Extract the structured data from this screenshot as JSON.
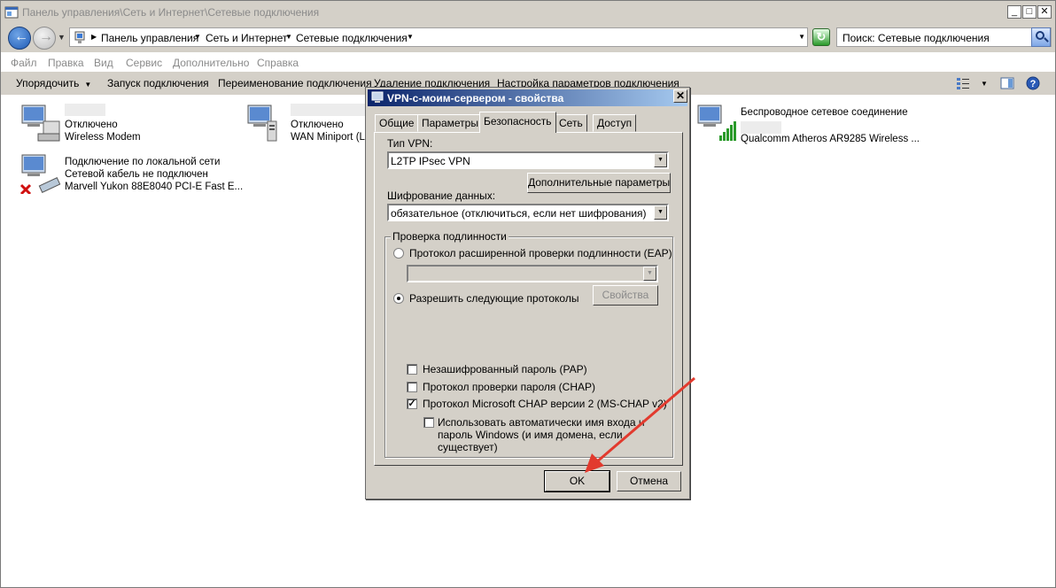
{
  "window": {
    "title": "Панель управления\\Сеть и Интернет\\Сетевые подключения",
    "minimize": "_",
    "maximize": "□",
    "close": "✕"
  },
  "address": {
    "crumbs": [
      "Панель управления",
      "Сеть и Интернет",
      "Сетевые подключения"
    ],
    "search_placeholder": "Поиск: Сетевые подключения"
  },
  "menu": [
    "Файл",
    "Правка",
    "Вид",
    "Сервис",
    "Дополнительно",
    "Справка"
  ],
  "commands": {
    "organize": "Упорядочить",
    "start": "Запуск подключения",
    "rename": "Переименование подключения",
    "delete": "Удаление подключения",
    "settings": "Настройка параметров подключения"
  },
  "connections": [
    {
      "status": "Отключено",
      "device": "Wireless Modem"
    },
    {
      "status": "Отключено",
      "device": "WAN Miniport (L2T"
    },
    {
      "name": "Беспроводное сетевое соединение",
      "device": "Qualcomm Atheros AR9285 Wireless ..."
    },
    {
      "name": "Подключение по локальной сети",
      "status": "Сетевой кабель не подключен",
      "device": "Marvell Yukon 88E8040 PCI-E Fast E..."
    }
  ],
  "dialog": {
    "title": "VPN-с-моим-сервером - свойства",
    "close": "✕",
    "tabs": [
      "Общие",
      "Параметры",
      "Безопасность",
      "Сеть",
      "Доступ"
    ],
    "vpn_type_label": "Тип VPN:",
    "vpn_type_value": "L2TP IPsec VPN",
    "advanced_button": "Дополнительные параметры",
    "encryption_label": "Шифрование данных:",
    "encryption_value": "обязательное (отключиться, если нет шифрования)",
    "auth_group": "Проверка подлинности",
    "eap_radio": "Протокол расширенной проверки подлинности (EAP)",
    "allow_radio": "Разрешить следующие протоколы",
    "properties_button": "Свойства",
    "pap": "Незашифрованный пароль (PAP)",
    "chap": "Протокол проверки пароля (CHAP)",
    "mschapv2": "Протокол Microsoft CHAP версии 2 (MS-CHAP v2)",
    "auto_login_1": "Использовать автоматически имя входа и",
    "auto_login_2": "пароль Windows (и имя домена, если",
    "auto_login_3": "существует)",
    "ok": "OK",
    "cancel": "Отмена",
    "checkmark": "✓"
  },
  "colors": {
    "titlebar": "#0a246a",
    "arrow": "#e23a2e",
    "face": "#d4d0c8"
  }
}
